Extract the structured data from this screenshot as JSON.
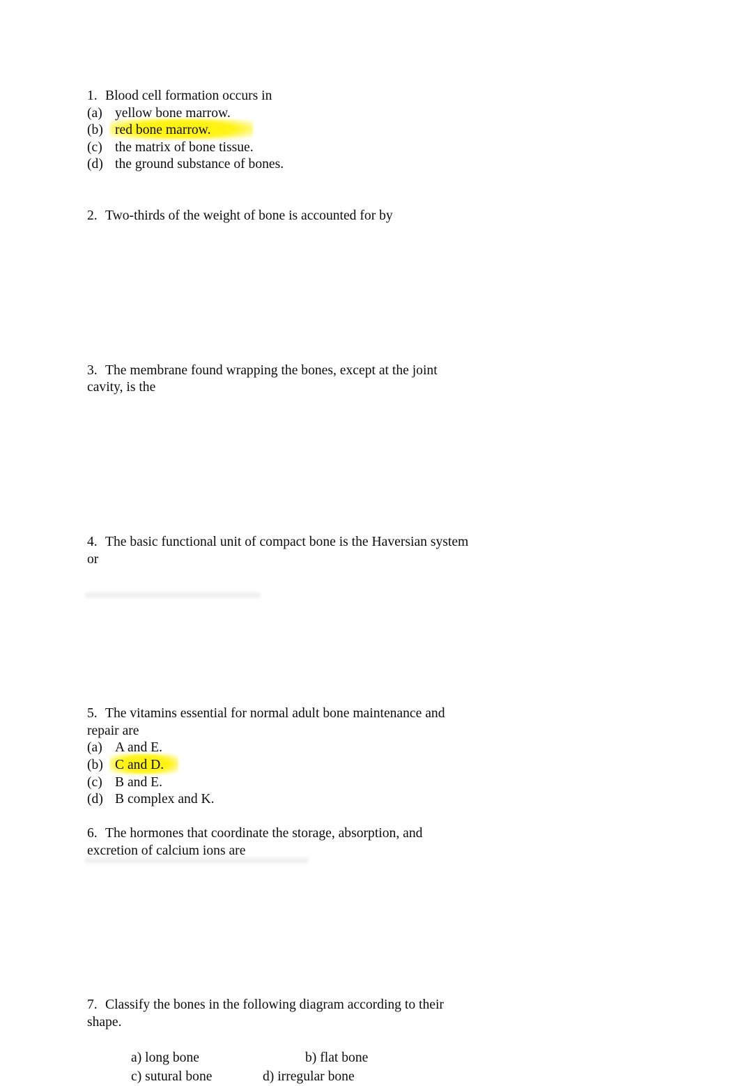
{
  "document": {
    "background_color": "#ffffff",
    "text_color": "#0d0d0d",
    "highlight_color": "#fff200"
  },
  "questions": [
    {
      "number": "1.",
      "stem": "Blood cell formation occurs in",
      "options": [
        {
          "marker": "(a)",
          "text": "yellow bone marrow.",
          "highlighted": false
        },
        {
          "marker": "(b)",
          "text": "red bone marrow.",
          "highlighted": true
        },
        {
          "marker": "(c)",
          "text": "the matrix of bone tissue.",
          "highlighted": false
        },
        {
          "marker": "(d)",
          "text": "the ground substance of bones.",
          "highlighted": false
        }
      ]
    },
    {
      "number": "2.",
      "stem": "Two-thirds of the weight of bone is accounted for by",
      "options": []
    },
    {
      "number": "3.",
      "stem": "The membrane found wrapping the bones, except at the joint cavity, is the",
      "options": []
    },
    {
      "number": "4.",
      "stem": "The basic functional unit of compact bone is the Haversian system or",
      "options": []
    },
    {
      "number": "5.",
      "stem": "The vitamins essential for normal adult bone maintenance and repair are",
      "options": [
        {
          "marker": "(a)",
          "text": "A and E.",
          "highlighted": false
        },
        {
          "marker": "(b)",
          "text": "C and D.",
          "highlighted": true
        },
        {
          "marker": "(c)",
          "text": "B and E.",
          "highlighted": false
        },
        {
          "marker": "(d)",
          "text": "B complex and K.",
          "highlighted": false
        }
      ]
    },
    {
      "number": "6.",
      "stem": "The hormones that coordinate the storage, absorption, and excretion of calcium ions are",
      "options": []
    },
    {
      "number": "7.",
      "stem": "Classify the bones in the following diagram according to their shape.",
      "answer_grid": {
        "row1": {
          "left": "a) long bone",
          "right": "b) flat bone"
        },
        "row2": {
          "left": "c) sutural bone",
          "right": "d) irregular bone"
        }
      }
    }
  ]
}
